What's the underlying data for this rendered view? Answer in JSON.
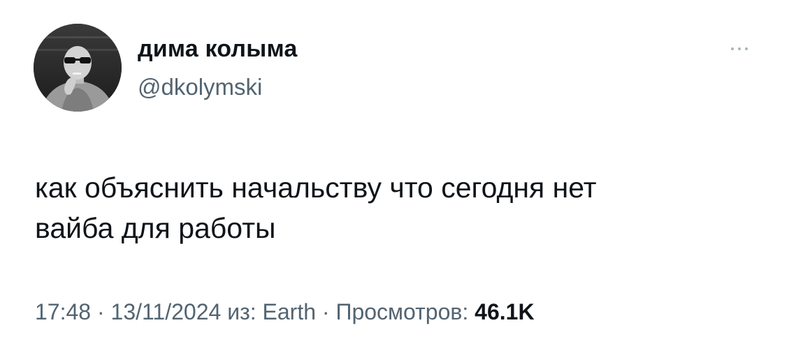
{
  "author": {
    "display_name": "дима колыма",
    "handle": "@dkolymski"
  },
  "tweet": {
    "lines": [
      "как объяснить начальству что сегодня нет",
      "вайба для работы"
    ]
  },
  "meta": {
    "time": "17:48",
    "separator": " · ",
    "date": "13/11/2024",
    "source_prefix": " из: ",
    "source": "Earth",
    "views_label": "Просмотров: ",
    "views_count": "46.1K"
  },
  "icons": {
    "more": "more-icon"
  }
}
